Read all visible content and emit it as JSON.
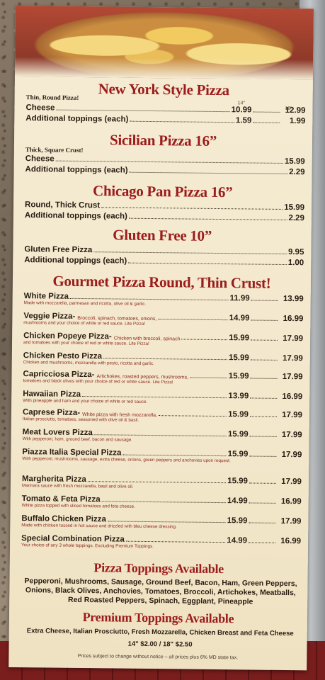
{
  "ny": {
    "title": "New York Style Pizza",
    "subtitle": "Thin, Round Pizza!",
    "size1": "14\"",
    "size2": "18\"",
    "items": [
      {
        "name": "Cheese",
        "p1": "10.99",
        "p2": "12.99"
      },
      {
        "name": "Additional toppings (each)",
        "p1": "1.59",
        "p2": "1.99"
      }
    ]
  },
  "sicilian": {
    "title": "Sicilian Pizza 16”",
    "subtitle": "Thick, Square Crust!",
    "items": [
      {
        "name": "Cheese",
        "price": "15.99"
      },
      {
        "name": "Additional toppings (each)",
        "price": "2.29"
      }
    ]
  },
  "chicago": {
    "title": "Chicago Pan Pizza 16”",
    "items": [
      {
        "name": "Round, Thick Crust",
        "price": "15.99"
      },
      {
        "name": "Additional toppings (each)",
        "price": "2.29"
      }
    ]
  },
  "gluten": {
    "title": "Gluten Free 10”",
    "items": [
      {
        "name": "Gluten Free Pizza",
        "price": "9.95"
      },
      {
        "name": "Additional toppings (each)",
        "price": "1.00"
      }
    ]
  },
  "gourmet": {
    "title": "Gourmet Pizza Round, Thin Crust!",
    "items": [
      {
        "name": "White Pizza",
        "inline": "",
        "p1": "11.99",
        "p2": "13.99",
        "desc": "Made with mozzarella, parmesan and ricotta, olive oil & garlic."
      },
      {
        "name": "Veggie Pizza-",
        "inline": "Broccoli, spinach, tomatoes, onions,",
        "p1": "14.99",
        "p2": "16.99",
        "desc": "mushrooms and your choice of white or red sauce. Lite Pizza!"
      },
      {
        "name": "Chicken Popeye Pizza-",
        "inline": "Chicken with broccoli, spinach",
        "p1": "15.99",
        "p2": "17.99",
        "desc": "and tomatoes with your choice of red or white sauce. Lite Pizza!"
      },
      {
        "name": "Chicken Pesto Pizza",
        "inline": "",
        "p1": "15.99",
        "p2": "17.99",
        "desc": "Chicken and mushrooms, mozzarella with pesto, ricotta and garlic."
      },
      {
        "name": "Capricciosa Pizza-",
        "inline": "Artichokes, roasted peppers, mushrooms,",
        "p1": "15.99",
        "p2": "17.99",
        "desc": "tomatoes and black olives with your choice of red or white sauce. Lite Pizza!"
      },
      {
        "name": "Hawaiian Pizza",
        "inline": "",
        "p1": "13.99",
        "p2": "16.99",
        "desc": "With pineapple and ham and your choice of white or red sauce."
      },
      {
        "name": "Caprese Pizza-",
        "inline": "White pizza with fresh mozzarella,",
        "p1": "15.99",
        "p2": "17.99",
        "desc": "Italian prosciutto, tomatoes, seasoned with olive oil & basil."
      },
      {
        "name": "Meat Lovers Pizza",
        "inline": "",
        "p1": "15.99",
        "p2": "17.99",
        "desc": "With pepperoni, ham, ground beef, bacon and sausage."
      },
      {
        "name": "Piazza Italia Special Pizza",
        "inline": "",
        "p1": "15.99",
        "p2": "17.99",
        "desc": "With pepperoni, mushrooms, sausage, extra cheese, onions, green peppers and anchovies upon request."
      },
      {
        "name": "Margherita Pizza",
        "inline": "",
        "p1": "15.99",
        "p2": "17.99",
        "desc": "Marinara sauce with fresh mozzarella, basil and olive oil."
      },
      {
        "name": "Tomato & Feta Pizza",
        "inline": "",
        "p1": "14.99",
        "p2": "16.99",
        "desc": "White pizza topped with sliced tomatoes and feta cheese."
      },
      {
        "name": "Buffalo Chicken Pizza",
        "inline": "",
        "p1": "15.99",
        "p2": "17.99",
        "desc": "Made with chicken tossed in hot sauce and drizzled with bleu cheese dressing."
      },
      {
        "name": "Special Combination Pizza",
        "inline": "",
        "p1": "14.99",
        "p2": "16.99",
        "desc": "Your choice of any 3 whole toppings. Excluding Premium Toppings."
      }
    ]
  },
  "toppings": {
    "title": "Pizza Toppings Available",
    "line1": "Pepperoni, Mushrooms, Sausage, Ground Beef, Bacon, Ham, Green Peppers,",
    "line2": "Onions, Black Olives, Anchovies, Tomatoes, Broccoli, Artichokes, Meatballs,",
    "line3": "Red Roasted Peppers, Spinach, Eggplant, Pineapple"
  },
  "premium": {
    "title": "Premium Toppings Available",
    "line1": "Extra Cheese, Italian Prosciutto, Fresh Mozzarella, Chicken Breast and Feta Cheese",
    "prices": "14\" $2.00 / 18\" $2.50"
  },
  "footnote": "Prices subject to change without notice – all prices plus 6% MD state tax."
}
